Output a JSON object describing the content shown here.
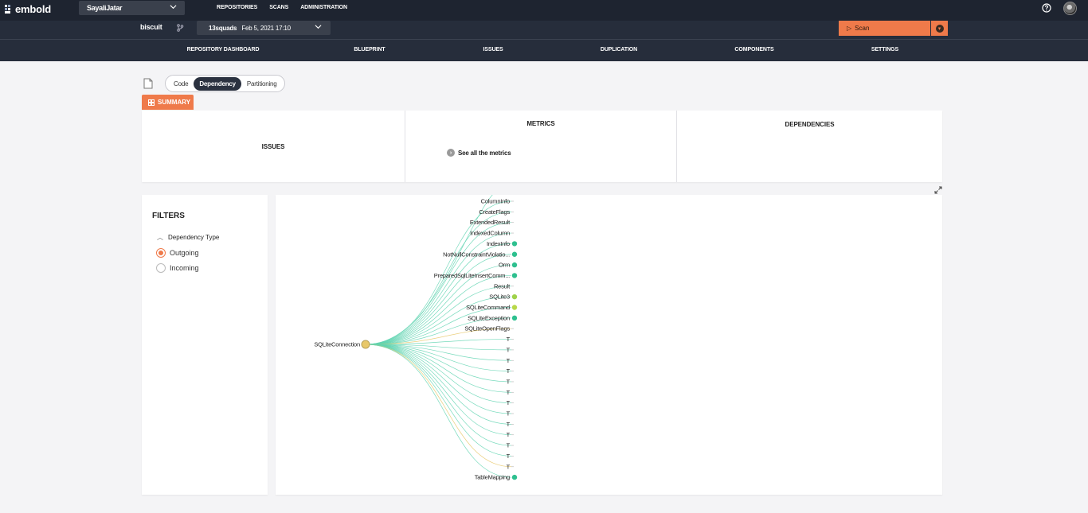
{
  "app": {
    "logo": "embold",
    "workspace": "SayaliJatar",
    "nav": [
      "REPOSITORIES",
      "SCANS",
      "ADMINISTRATION"
    ]
  },
  "repo": {
    "name": "biscuit",
    "snapshot_name": "13squads",
    "snapshot_date": "Feb 5, 2021 17:10",
    "scan_label": "Scan"
  },
  "tabs": [
    "REPOSITORY DASHBOARD",
    "BLUEPRINT",
    "ISSUES",
    "DUPLICATION",
    "COMPONENTS",
    "SETTINGS"
  ],
  "view_switch": {
    "options": [
      "Code",
      "Dependency",
      "Partitioning"
    ],
    "active": "Dependency"
  },
  "summary": {
    "button": "SUMMARY",
    "issues_title": "ISSUES",
    "metrics_title": "METRICS",
    "metrics_link": "See all the metrics",
    "dependencies_title": "DEPENDENCIES"
  },
  "filters": {
    "title": "FILTERS",
    "group": "Dependency Type",
    "options": [
      {
        "label": "Outgoing",
        "checked": true
      },
      {
        "label": "Incoming",
        "checked": false
      }
    ]
  },
  "graph": {
    "root": "SQLiteConnection",
    "root_color": "#e8c86a",
    "nodes": [
      {
        "label": "ColumnInfo",
        "dot": null
      },
      {
        "label": "CreateFlags",
        "dot": null
      },
      {
        "label": "ExtendedResult",
        "dot": null
      },
      {
        "label": "IndexedColumn",
        "dot": null
      },
      {
        "label": "IndexInfo",
        "dot": "#2ec08f"
      },
      {
        "label": "NotNullConstraintViolatio...",
        "dot": "#2ec08f"
      },
      {
        "label": "Orm",
        "dot": "#2ec08f"
      },
      {
        "label": "PreparedSqlLiteInsertComm...",
        "dot": "#2ec08f"
      },
      {
        "label": "Result",
        "dot": null
      },
      {
        "label": "SQLite3",
        "dot": "#9fd24a"
      },
      {
        "label": "SQLiteCommand",
        "dot": "#b8d84a"
      },
      {
        "label": "SQLiteException",
        "dot": "#2ec08f"
      },
      {
        "label": "SQLiteOpenFlags",
        "dot": null
      },
      {
        "label": "T",
        "dot": null
      },
      {
        "label": "T",
        "dot": null
      },
      {
        "label": "T",
        "dot": null
      },
      {
        "label": "T",
        "dot": null
      },
      {
        "label": "T",
        "dot": null
      },
      {
        "label": "T",
        "dot": null
      },
      {
        "label": "T",
        "dot": null
      },
      {
        "label": "T",
        "dot": null
      },
      {
        "label": "T",
        "dot": null
      },
      {
        "label": "T",
        "dot": null
      },
      {
        "label": "T",
        "dot": null
      },
      {
        "label": "T",
        "dot": null
      },
      {
        "label": "T",
        "dot": null
      },
      {
        "label": "TableMapping",
        "dot": "#2ec08f"
      }
    ],
    "edge_color": "#5fd3b0",
    "edge_color_alt": "#e8c86a"
  }
}
